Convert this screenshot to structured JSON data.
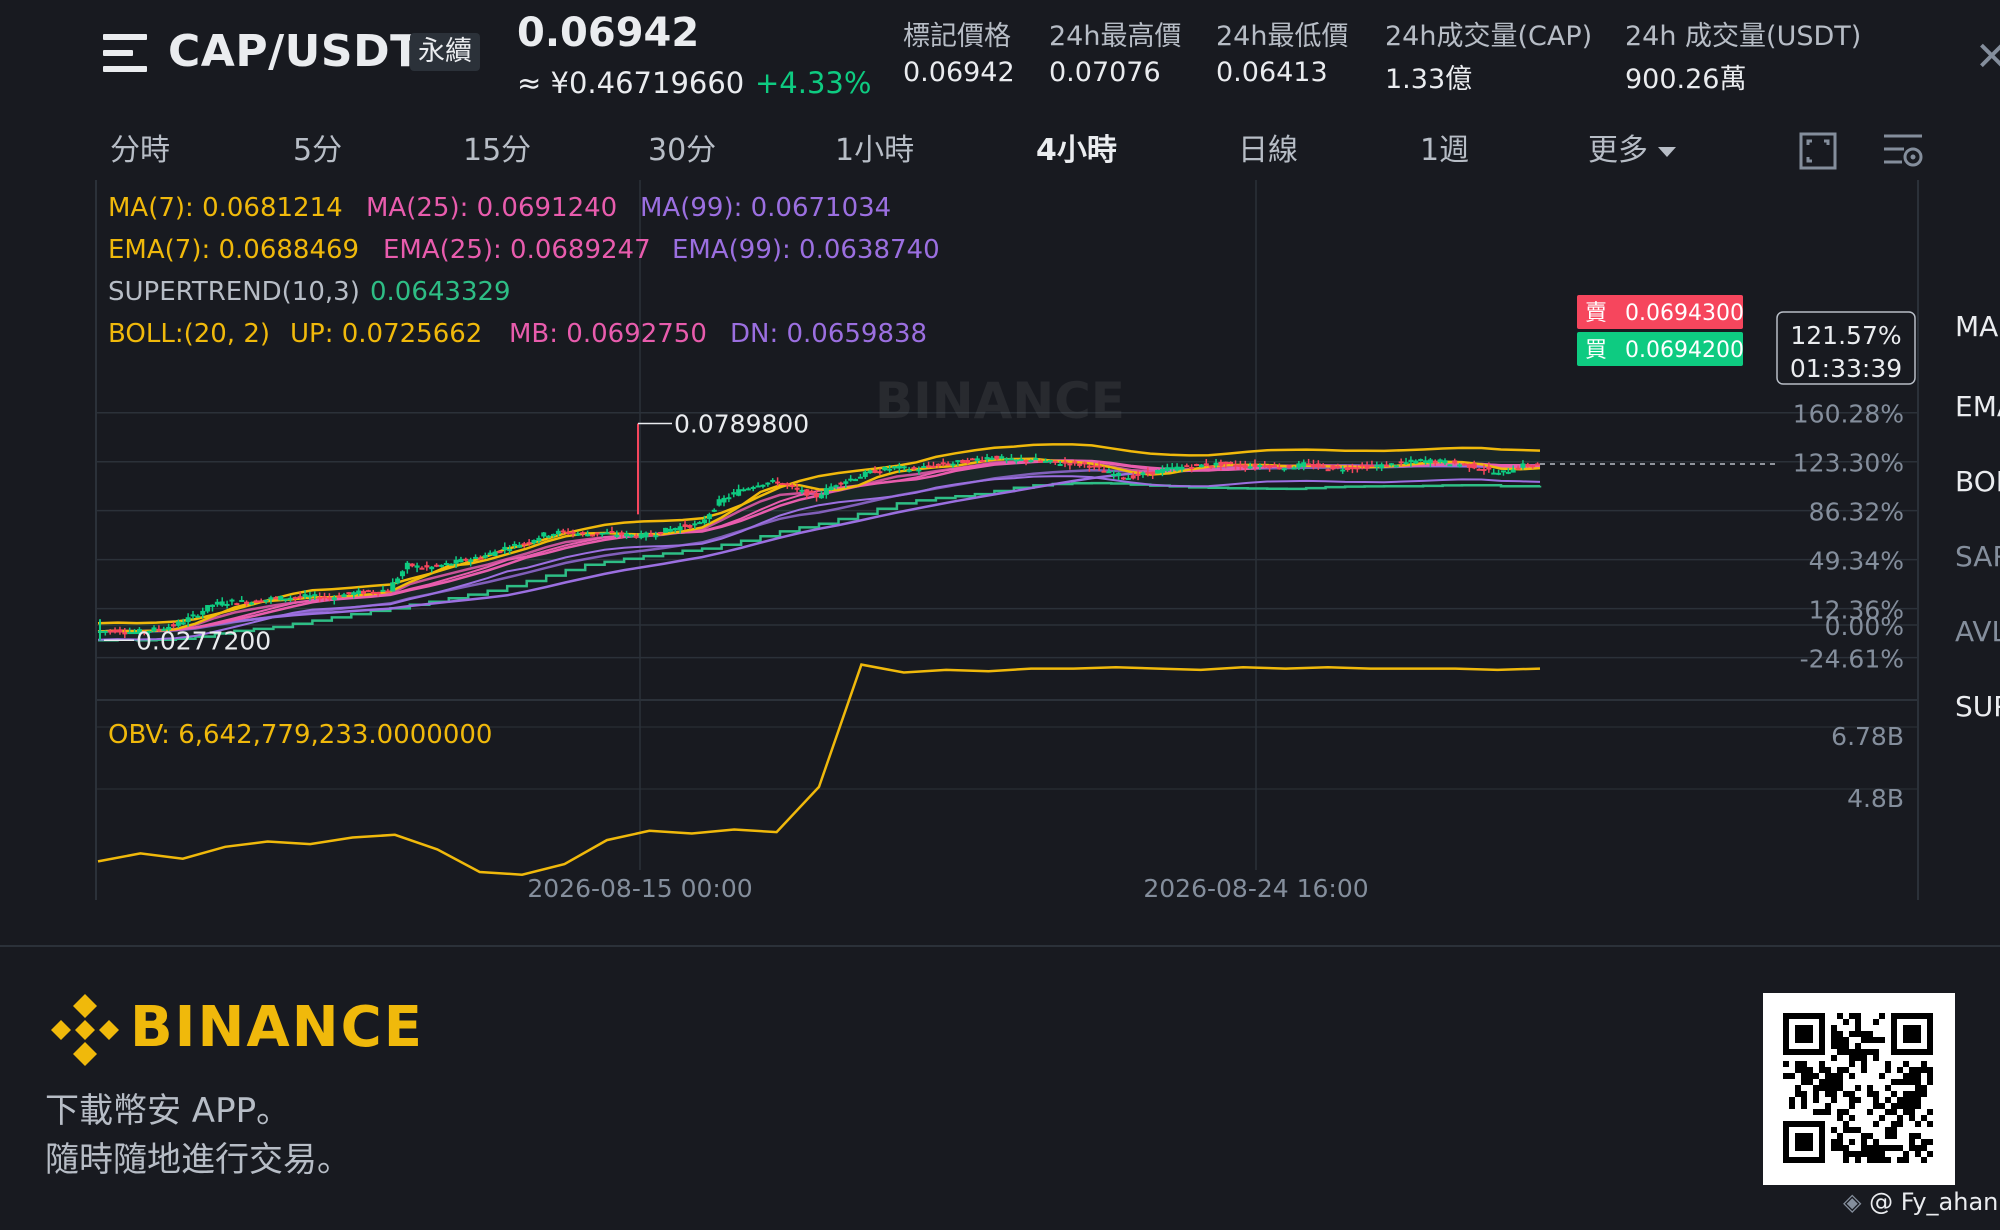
{
  "header": {
    "symbol": "CAP/USDT",
    "contract_type": "永續",
    "last_price": "0.06942",
    "cny_price": "≈ ¥0.46719660",
    "change_pct": "+4.33%",
    "stats": [
      {
        "label": "標記價格",
        "value": "0.06942"
      },
      {
        "label": "24h最高價",
        "value": "0.07076"
      },
      {
        "label": "24h最低價",
        "value": "0.06413"
      },
      {
        "label": "24h成交量(CAP)",
        "value": "1.33億"
      },
      {
        "label": "24h 成交量(USDT)",
        "value": "900.26萬"
      }
    ]
  },
  "intervals": {
    "items": [
      "分時",
      "5分",
      "15分",
      "30分",
      "1小時",
      "4小時",
      "日線",
      "1週"
    ],
    "active": "4小時",
    "more_label": "更多"
  },
  "indicators": {
    "ma7": "MA(7): 0.0681214",
    "ma25": "MA(25): 0.0691240",
    "ma99": "MA(99): 0.0671034",
    "ema7": "EMA(7): 0.0688469",
    "ema25": "EMA(25): 0.0689247",
    "ema99": "EMA(99): 0.0638740",
    "supertrend_label": "SUPERTREND(10,3)",
    "supertrend_value": "0.0643329",
    "boll_label": "BOLL:(20, 2)",
    "boll_up": "UP: 0.0725662",
    "boll_mb": "MB: 0.0692750",
    "boll_dn": "DN: 0.0659838",
    "obv": "OBV: 6,642,779,233.0000000"
  },
  "chart_data": {
    "type": "candlestick",
    "price_axis_ticks": [
      "160.28%",
      "123.30%",
      "86.32%",
      "49.34%",
      "12.36%",
      "0.00%",
      "-24.61%"
    ],
    "obv_axis_ticks": [
      "6.78B",
      "4.8B"
    ],
    "time_axis_ticks": [
      "2026-08-15 00:00",
      "2026-08-24 16:00"
    ],
    "high_marker": "0.0789800",
    "low_marker": "0.0277200",
    "ask_label": "賣",
    "ask_price": "0.0694300",
    "bid_label": "買",
    "bid_price": "0.0694200",
    "current_pct": "121.57%",
    "countdown": "01:33:39",
    "close_series": [
      0.0298,
      0.0301,
      0.0296,
      0.0303,
      0.0312,
      0.0334,
      0.0362,
      0.0369,
      0.0368,
      0.0376,
      0.0379,
      0.0381,
      0.0378,
      0.0388,
      0.0392,
      0.0397,
      0.0455,
      0.0448,
      0.0457,
      0.0468,
      0.0478,
      0.0496,
      0.0508,
      0.0527,
      0.0534,
      0.0528,
      0.0531,
      0.0527,
      0.0524,
      0.0534,
      0.0546,
      0.0552,
      0.0605,
      0.0631,
      0.0648,
      0.0652,
      0.0632,
      0.0618,
      0.0648,
      0.0663,
      0.0678,
      0.0686,
      0.0681,
      0.0692,
      0.0696,
      0.0704,
      0.0712,
      0.0702,
      0.0705,
      0.0698,
      0.0696,
      0.0691,
      0.0672,
      0.0663,
      0.0672,
      0.0682,
      0.0688,
      0.0693,
      0.0694,
      0.0689,
      0.0692,
      0.0686,
      0.0693,
      0.0687,
      0.0685,
      0.0688,
      0.069,
      0.0696,
      0.0702,
      0.07,
      0.0694,
      0.0686,
      0.067,
      0.0689,
      0.0694
    ],
    "obv_series": [
      5.4,
      5.46,
      5.42,
      5.51,
      5.55,
      5.53,
      5.58,
      5.6,
      5.49,
      5.32,
      5.3,
      5.38,
      5.56,
      5.63,
      5.61,
      5.64,
      5.62,
      5.96,
      6.88,
      6.82,
      6.84,
      6.83,
      6.85,
      6.85,
      6.86,
      6.85,
      6.84,
      6.86,
      6.85,
      6.86,
      6.85,
      6.85,
      6.85,
      6.84,
      6.85
    ]
  },
  "right_column": {
    "items": [
      "MA",
      "EMA",
      "BOLL",
      "SAR",
      "AVL",
      "SUPER"
    ]
  },
  "footer": {
    "brand": "BINANCE",
    "line1": "下載幣安 APP。",
    "line2": "隨時隨地進行交易。",
    "watermark_text": "@ Fy_ahan"
  },
  "colors": {
    "background": "#181A20",
    "up": "#0ECB81",
    "down": "#F6465D",
    "brand": "#F0B90B",
    "ma7": "#F0B90B",
    "ma25": "#E85CAD",
    "ma99": "#9B6FE0",
    "supertrend": "#2EBD85"
  }
}
